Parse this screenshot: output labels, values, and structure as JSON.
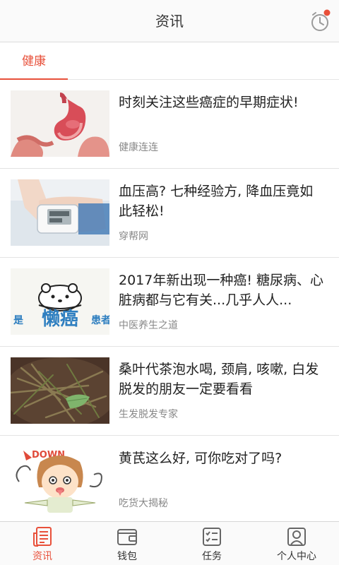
{
  "header": {
    "title": "资讯"
  },
  "tabs": [
    {
      "label": "健康",
      "active": true
    }
  ],
  "articles": [
    {
      "headline": "时刻关注这些癌症的早期症状!",
      "source": "健康连连",
      "image": "stomach-illustration"
    },
    {
      "headline": "血压高? 七种经验方, 降血压竟如此轻松!",
      "source": "穿帮网",
      "image": "blood-pressure-monitor"
    },
    {
      "headline": "2017年新出现一种癌! 糖尿病、心脏病都与它有关...几乎人人...",
      "source": "中医养生之道",
      "image": "lazy-cancer-bear",
      "image_text": "懒癌",
      "image_text_left": "是",
      "image_text_right": "患者"
    },
    {
      "headline": "桑叶代茶泡水喝, 颈肩, 咳嗽, 白发脱发的朋友一定要看看",
      "source": "生发脱发专家",
      "image": "mulberry-twigs"
    },
    {
      "headline": "黄芪这么好, 可你吃对了吗?",
      "source": "吃货大揭秘",
      "image": "cartoon-girl",
      "image_text": "DOWN"
    }
  ],
  "bottom_nav": [
    {
      "label": "资讯",
      "icon": "news-icon",
      "active": true
    },
    {
      "label": "钱包",
      "icon": "wallet-icon",
      "active": false
    },
    {
      "label": "任务",
      "icon": "task-icon",
      "active": false
    },
    {
      "label": "个人中心",
      "icon": "profile-icon",
      "active": false
    }
  ],
  "colors": {
    "accent": "#e8503a",
    "notification_dot": "#e8503a",
    "nav_icon": "#666666"
  }
}
